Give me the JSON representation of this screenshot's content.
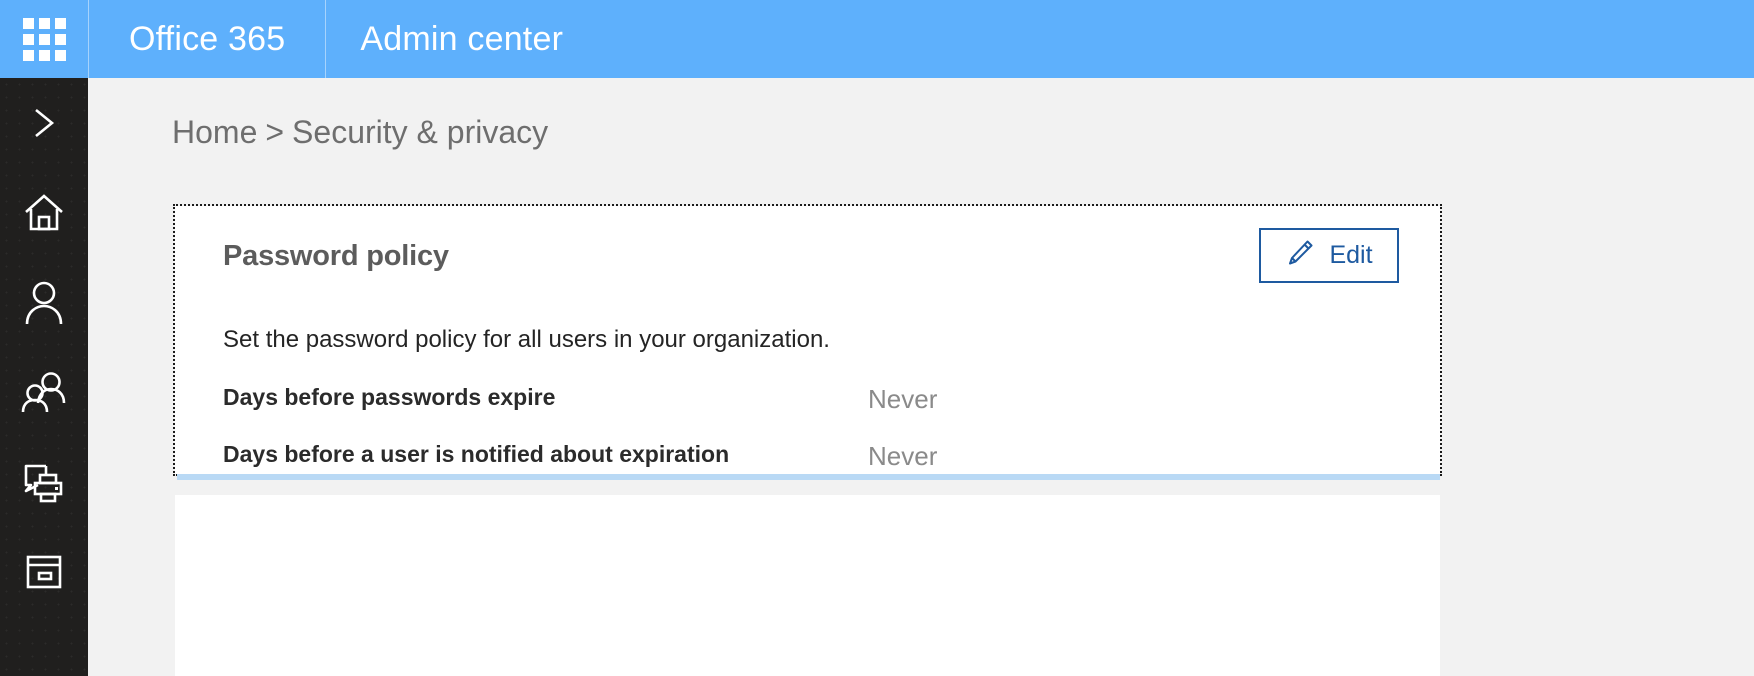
{
  "suite_bar": {
    "waffle_icon": "app-launcher-waffle-icon",
    "brand": "Office 365",
    "app_name": "Admin center",
    "background_color": "#5eb0fc"
  },
  "nav_rail": {
    "background_color": "#201f1e",
    "items": [
      {
        "icon": "chevron-right-icon",
        "name": "expand-nav"
      },
      {
        "icon": "home-icon",
        "name": "home"
      },
      {
        "icon": "person-icon",
        "name": "users"
      },
      {
        "icon": "people-group-icon",
        "name": "groups"
      },
      {
        "icon": "device-printer-icon",
        "name": "resources"
      },
      {
        "icon": "billing-card-icon",
        "name": "billing"
      }
    ]
  },
  "breadcrumb": {
    "home": "Home",
    "separator": ">",
    "current": "Security & privacy"
  },
  "password_policy_card": {
    "title": "Password policy",
    "edit_button": {
      "label": "Edit",
      "icon": "pencil-edit-icon",
      "border_color": "#1e5aa0"
    },
    "description": "Set the password policy for all users in your organization.",
    "rows": [
      {
        "label": "Days before passwords expire",
        "value": "Never"
      },
      {
        "label": "Days before a user is notified about expiration",
        "value": "Never"
      }
    ],
    "accent_color": "#b9d9f5"
  }
}
